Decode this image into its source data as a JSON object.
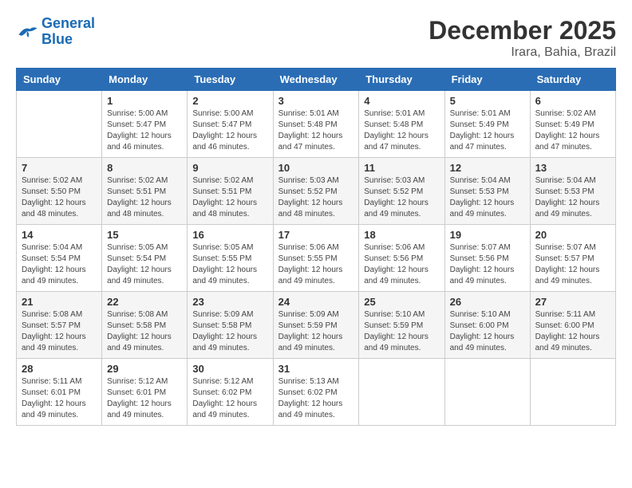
{
  "header": {
    "logo_line1": "General",
    "logo_line2": "Blue",
    "month": "December 2025",
    "location": "Irara, Bahia, Brazil"
  },
  "weekdays": [
    "Sunday",
    "Monday",
    "Tuesday",
    "Wednesday",
    "Thursday",
    "Friday",
    "Saturday"
  ],
  "weeks": [
    [
      {
        "day": "",
        "sunrise": "",
        "sunset": "",
        "daylight": ""
      },
      {
        "day": "1",
        "sunrise": "Sunrise: 5:00 AM",
        "sunset": "Sunset: 5:47 PM",
        "daylight": "Daylight: 12 hours and 46 minutes."
      },
      {
        "day": "2",
        "sunrise": "Sunrise: 5:00 AM",
        "sunset": "Sunset: 5:47 PM",
        "daylight": "Daylight: 12 hours and 46 minutes."
      },
      {
        "day": "3",
        "sunrise": "Sunrise: 5:01 AM",
        "sunset": "Sunset: 5:48 PM",
        "daylight": "Daylight: 12 hours and 47 minutes."
      },
      {
        "day": "4",
        "sunrise": "Sunrise: 5:01 AM",
        "sunset": "Sunset: 5:48 PM",
        "daylight": "Daylight: 12 hours and 47 minutes."
      },
      {
        "day": "5",
        "sunrise": "Sunrise: 5:01 AM",
        "sunset": "Sunset: 5:49 PM",
        "daylight": "Daylight: 12 hours and 47 minutes."
      },
      {
        "day": "6",
        "sunrise": "Sunrise: 5:02 AM",
        "sunset": "Sunset: 5:49 PM",
        "daylight": "Daylight: 12 hours and 47 minutes."
      }
    ],
    [
      {
        "day": "7",
        "sunrise": "Sunrise: 5:02 AM",
        "sunset": "Sunset: 5:50 PM",
        "daylight": "Daylight: 12 hours and 48 minutes."
      },
      {
        "day": "8",
        "sunrise": "Sunrise: 5:02 AM",
        "sunset": "Sunset: 5:51 PM",
        "daylight": "Daylight: 12 hours and 48 minutes."
      },
      {
        "day": "9",
        "sunrise": "Sunrise: 5:02 AM",
        "sunset": "Sunset: 5:51 PM",
        "daylight": "Daylight: 12 hours and 48 minutes."
      },
      {
        "day": "10",
        "sunrise": "Sunrise: 5:03 AM",
        "sunset": "Sunset: 5:52 PM",
        "daylight": "Daylight: 12 hours and 48 minutes."
      },
      {
        "day": "11",
        "sunrise": "Sunrise: 5:03 AM",
        "sunset": "Sunset: 5:52 PM",
        "daylight": "Daylight: 12 hours and 49 minutes."
      },
      {
        "day": "12",
        "sunrise": "Sunrise: 5:04 AM",
        "sunset": "Sunset: 5:53 PM",
        "daylight": "Daylight: 12 hours and 49 minutes."
      },
      {
        "day": "13",
        "sunrise": "Sunrise: 5:04 AM",
        "sunset": "Sunset: 5:53 PM",
        "daylight": "Daylight: 12 hours and 49 minutes."
      }
    ],
    [
      {
        "day": "14",
        "sunrise": "Sunrise: 5:04 AM",
        "sunset": "Sunset: 5:54 PM",
        "daylight": "Daylight: 12 hours and 49 minutes."
      },
      {
        "day": "15",
        "sunrise": "Sunrise: 5:05 AM",
        "sunset": "Sunset: 5:54 PM",
        "daylight": "Daylight: 12 hours and 49 minutes."
      },
      {
        "day": "16",
        "sunrise": "Sunrise: 5:05 AM",
        "sunset": "Sunset: 5:55 PM",
        "daylight": "Daylight: 12 hours and 49 minutes."
      },
      {
        "day": "17",
        "sunrise": "Sunrise: 5:06 AM",
        "sunset": "Sunset: 5:55 PM",
        "daylight": "Daylight: 12 hours and 49 minutes."
      },
      {
        "day": "18",
        "sunrise": "Sunrise: 5:06 AM",
        "sunset": "Sunset: 5:56 PM",
        "daylight": "Daylight: 12 hours and 49 minutes."
      },
      {
        "day": "19",
        "sunrise": "Sunrise: 5:07 AM",
        "sunset": "Sunset: 5:56 PM",
        "daylight": "Daylight: 12 hours and 49 minutes."
      },
      {
        "day": "20",
        "sunrise": "Sunrise: 5:07 AM",
        "sunset": "Sunset: 5:57 PM",
        "daylight": "Daylight: 12 hours and 49 minutes."
      }
    ],
    [
      {
        "day": "21",
        "sunrise": "Sunrise: 5:08 AM",
        "sunset": "Sunset: 5:57 PM",
        "daylight": "Daylight: 12 hours and 49 minutes."
      },
      {
        "day": "22",
        "sunrise": "Sunrise: 5:08 AM",
        "sunset": "Sunset: 5:58 PM",
        "daylight": "Daylight: 12 hours and 49 minutes."
      },
      {
        "day": "23",
        "sunrise": "Sunrise: 5:09 AM",
        "sunset": "Sunset: 5:58 PM",
        "daylight": "Daylight: 12 hours and 49 minutes."
      },
      {
        "day": "24",
        "sunrise": "Sunrise: 5:09 AM",
        "sunset": "Sunset: 5:59 PM",
        "daylight": "Daylight: 12 hours and 49 minutes."
      },
      {
        "day": "25",
        "sunrise": "Sunrise: 5:10 AM",
        "sunset": "Sunset: 5:59 PM",
        "daylight": "Daylight: 12 hours and 49 minutes."
      },
      {
        "day": "26",
        "sunrise": "Sunrise: 5:10 AM",
        "sunset": "Sunset: 6:00 PM",
        "daylight": "Daylight: 12 hours and 49 minutes."
      },
      {
        "day": "27",
        "sunrise": "Sunrise: 5:11 AM",
        "sunset": "Sunset: 6:00 PM",
        "daylight": "Daylight: 12 hours and 49 minutes."
      }
    ],
    [
      {
        "day": "28",
        "sunrise": "Sunrise: 5:11 AM",
        "sunset": "Sunset: 6:01 PM",
        "daylight": "Daylight: 12 hours and 49 minutes."
      },
      {
        "day": "29",
        "sunrise": "Sunrise: 5:12 AM",
        "sunset": "Sunset: 6:01 PM",
        "daylight": "Daylight: 12 hours and 49 minutes."
      },
      {
        "day": "30",
        "sunrise": "Sunrise: 5:12 AM",
        "sunset": "Sunset: 6:02 PM",
        "daylight": "Daylight: 12 hours and 49 minutes."
      },
      {
        "day": "31",
        "sunrise": "Sunrise: 5:13 AM",
        "sunset": "Sunset: 6:02 PM",
        "daylight": "Daylight: 12 hours and 49 minutes."
      },
      {
        "day": "",
        "sunrise": "",
        "sunset": "",
        "daylight": ""
      },
      {
        "day": "",
        "sunrise": "",
        "sunset": "",
        "daylight": ""
      },
      {
        "day": "",
        "sunrise": "",
        "sunset": "",
        "daylight": ""
      }
    ]
  ]
}
